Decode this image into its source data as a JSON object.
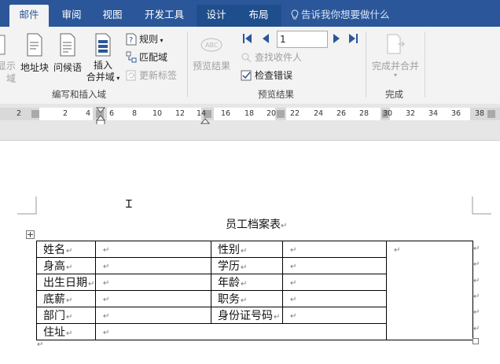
{
  "tabs": [
    {
      "label": "邮件",
      "active": true
    },
    {
      "label": "审阅"
    },
    {
      "label": "视图"
    },
    {
      "label": "开发工具"
    },
    {
      "label": "设计",
      "contextual": true
    },
    {
      "label": "布局"
    }
  ],
  "tell_me": "告诉我你想要做什么",
  "ribbon": {
    "group1": {
      "label": "编写和插入域",
      "partial_top": "显示",
      "partial_bottom": "域",
      "address_block": "地址块",
      "greeting_line": "问候语",
      "insert_field_line1": "插入",
      "insert_field_line2": "合并域",
      "rules": "规则",
      "match_fields": "匹配域",
      "update_labels": "更新标签"
    },
    "group2": {
      "label": "预览结果",
      "preview_results": "预览结果",
      "record_value": "1",
      "find_recipient": "查找收件人",
      "check_errors": "检查错误"
    },
    "group3": {
      "label": "完成",
      "finish_merge": "完成并合并"
    }
  },
  "ruler": {
    "numbers": [
      "2",
      "2",
      "4",
      "6",
      "8",
      "10",
      "12",
      "14",
      "16",
      "18",
      "20",
      "22",
      "24",
      "26",
      "28",
      "30",
      "32",
      "34",
      "36",
      "38"
    ]
  },
  "document": {
    "title": "员工档案表",
    "paragraph_mark": "↵",
    "table": {
      "rows": [
        {
          "l1": "姓名",
          "l2": "性别"
        },
        {
          "l1": "身高",
          "l2": "学历"
        },
        {
          "l1": "出生日期",
          "l2": "年龄"
        },
        {
          "l1": "底薪",
          "l2": "职务"
        },
        {
          "l1": "部门",
          "l2": "身份证号码"
        },
        {
          "l1": "住址"
        }
      ]
    }
  },
  "colors": {
    "title_bar": "#2b579a",
    "ribbon_bg": "#f3f3f3",
    "accent_blue": "#2b579a"
  }
}
